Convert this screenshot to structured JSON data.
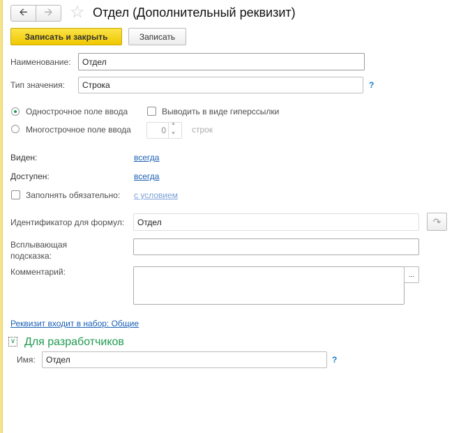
{
  "title": "Отдел (Дополнительный реквизит)",
  "toolbar": {
    "save_close": "Записать и закрыть",
    "save": "Записать"
  },
  "fields": {
    "name_label": "Наименование:",
    "name_value": "Отдел",
    "type_label": "Тип значения:",
    "type_value": "Строка",
    "help": "?",
    "single_line": "Однострочное поле ввода",
    "multi_line": "Многострочное поле ввода",
    "hyperlink": "Выводить в виде гиперссылки",
    "lines_value": "0",
    "lines_label": "строк",
    "visible_label": "Виден:",
    "visible_value": "всегда",
    "enabled_label": "Доступен:",
    "enabled_value": "всегда",
    "required_label": "Заполнять обязательно:",
    "required_value": "с условием",
    "id_label": "Идентификатор для формул:",
    "id_value": "Отдел",
    "tooltip_label": "Всплывающая подсказка:",
    "tooltip_value": "",
    "comment_label": "Комментарий:",
    "comment_value": "",
    "comment_btn": "...",
    "set_link": "Реквизит входит в набор: Общие"
  },
  "dev": {
    "title": "Для разработчиков",
    "name_label": "Имя:",
    "name_value": "Отдел",
    "help": "?"
  }
}
